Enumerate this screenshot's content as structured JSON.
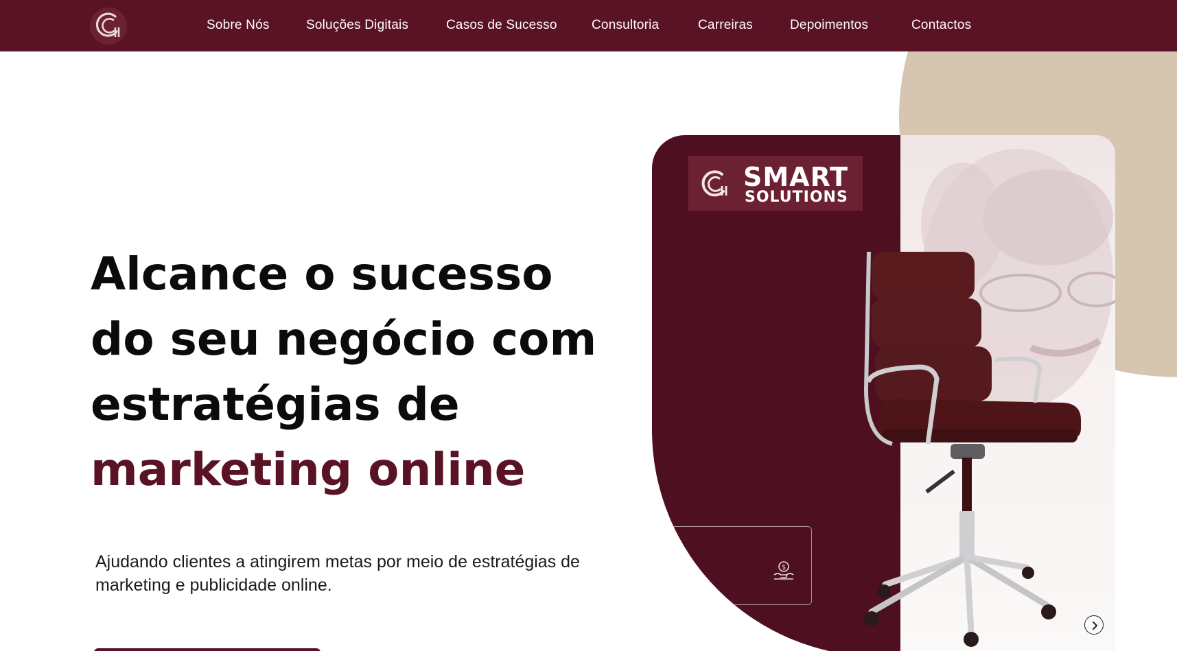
{
  "nav": {
    "logo_icon": "company-g-logo-icon",
    "links": [
      {
        "label": "Sobre Nós"
      },
      {
        "label": "Soluções Digitais"
      },
      {
        "label": "Casos de Sucesso"
      },
      {
        "label": "Consultoria"
      },
      {
        "label": "Carreiras"
      },
      {
        "label": "Depoimentos"
      },
      {
        "label": "Contactos"
      }
    ]
  },
  "hero": {
    "title_line_1": "Alcance o sucesso",
    "title_line_2": "do seu negócio com",
    "title_line_3": "estratégias de",
    "title_accent": "marketing online",
    "subtitle": "Ajudando clientes a atingirem metas por meio de estratégias de marketing e publicidade online."
  },
  "card": {
    "brand_line_1": "SMART",
    "brand_line_2": "SOLUTIONS",
    "info_icon": "money-hand-icon",
    "next_icon": "chevron-right-icon"
  },
  "colors": {
    "brand_primary": "#5a1325",
    "brand_dark": "#4e0f20",
    "accent_beige": "#d6c6b1",
    "text_dark": "#0b0b0b"
  }
}
